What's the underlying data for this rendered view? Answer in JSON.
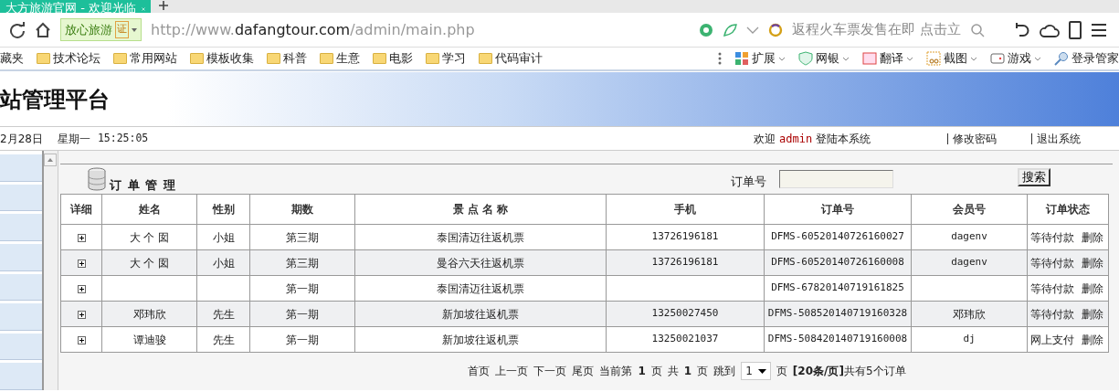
{
  "browser": {
    "tab_title": "大方旅游官网 - 欢迎光临",
    "address": {
      "badge": "放心旅游",
      "cert": "证",
      "url_prefix": "http://www.",
      "url_host": "dafangtour.com",
      "url_path": "/admin/main.php"
    },
    "search_placeholder": "返程火车票发售在即 点击立",
    "bookmarks": [
      "藏夹",
      "技术论坛",
      "常用网站",
      "模板收集",
      "科普",
      "生意",
      "电影",
      "学习",
      "代码审计"
    ],
    "tools": [
      {
        "kind": "grid",
        "label": "扩展"
      },
      {
        "kind": "shield",
        "label": "网银"
      },
      {
        "kind": "translate",
        "label": "翻译"
      },
      {
        "kind": "scissors",
        "label": "截图"
      },
      {
        "kind": "gamepad",
        "label": "游戏"
      },
      {
        "kind": "key",
        "label": "登录管家"
      }
    ]
  },
  "page": {
    "title": "站管理平台",
    "date": "2月28日",
    "weekday": "星期一",
    "time": "15:25:05",
    "welcome": "欢迎",
    "user": "admin",
    "welcome_suffix": "登陆本系统",
    "links": [
      "修改密码",
      "退出系统"
    ]
  },
  "orders": {
    "title": "订 单 管 理",
    "search_label": "订单号",
    "search_button": "搜索",
    "columns": [
      "详细",
      "姓名",
      "性别",
      "期数",
      "景 点 名 称",
      "手机",
      "订单号",
      "会员号",
      "订单状态"
    ],
    "rows": [
      {
        "name": "大 个 囡",
        "gender": "小姐",
        "period": "第三期",
        "spot": "泰国清迈往返机票",
        "phone": "13726196181",
        "order_no": "DFMS-60520140726160027",
        "member": "dagenv",
        "status": "等待付款",
        "action": "删除"
      },
      {
        "name": "大 个 囡",
        "gender": "小姐",
        "period": "第三期",
        "spot": "曼谷六天往返机票",
        "phone": "13726196181",
        "order_no": "DFMS-60520140726160008",
        "member": "dagenv",
        "status": "等待付款",
        "action": "删除"
      },
      {
        "name": "",
        "gender": "",
        "period": "第一期",
        "spot": "泰国清迈往返机票",
        "phone": "",
        "order_no": "DFMS-67820140719161825",
        "member": "",
        "status": "等待付款",
        "action": "删除"
      },
      {
        "name": "邓玮欣",
        "gender": "先生",
        "period": "第一期",
        "spot": "新加坡往返机票",
        "phone": "13250027450",
        "order_no": "DFMS-508520140719160328",
        "member": "邓玮欣",
        "status": "等待付款",
        "action": "删除"
      },
      {
        "name": "谭迪骏",
        "gender": "先生",
        "period": "第一期",
        "spot": "新加坡往返机票",
        "phone": "13250021037",
        "order_no": "DFMS-508420140719160008",
        "member": "dj",
        "status": "网上支付",
        "action": "删除"
      }
    ],
    "pager": {
      "links": [
        "首页",
        "上一页",
        "下一页",
        "尾页"
      ],
      "current_label": "当前第",
      "current": "1",
      "page_word": "页",
      "total_label": "共",
      "total": "1",
      "total_page_word": "页",
      "jump_label": "跳到",
      "jump_value": "1",
      "jump_page_word": "页",
      "per_page": "[20条/页]",
      "count_text": "共有5个订单"
    }
  }
}
